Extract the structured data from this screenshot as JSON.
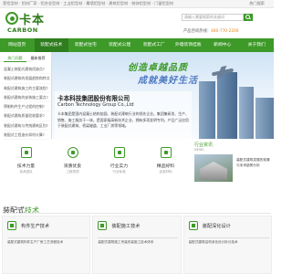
{
  "topbar": {
    "links": "营铝型材 · 铝材厂家 · 铝合金型材 · 工业铝型材 · 幕墙铝型材 · 建筑铝型材 · 装饰铝型材 · 门窗铝型材",
    "hotwords": "热门搜索"
  },
  "logo": {
    "cn": "卡本",
    "en": "CARBON"
  },
  "header": {
    "search_placeholder": "请输入需要搜索的关键词",
    "hotline_label": "产品咨询热线：",
    "hotline_number": "400-770-2200"
  },
  "nav": {
    "items": [
      {
        "label": "网站首页"
      },
      {
        "label": "装配式技术"
      },
      {
        "label": "装配式住宅"
      },
      {
        "label": "装配式公建"
      },
      {
        "label": "装配式工厂"
      },
      {
        "label": "外墙装饰挂板"
      },
      {
        "label": "新闻中心"
      },
      {
        "label": "关于我们"
      }
    ],
    "active_index": 1
  },
  "dropdown": {
    "tabs": [
      "热门问题",
      "最新推荐"
    ],
    "items": [
      "混凝土装配式建筑优缺点?",
      "装配式建筑的发展趋势和特点?",
      "装配式建筑施工的主要流程?",
      "装配式建筑的安装施工要点?",
      "预制构件生产过程的控制?",
      "装配式建筑质量验收要求?",
      "装配式建筑与传统建筑区别?",
      "装配式工程造价如何计算?"
    ]
  },
  "banner": {
    "slogan_line1": "创造卓越品质",
    "slogan_line2": "成就美好生活"
  },
  "company": {
    "name_cn": "卡本科技集团股份有限公司",
    "name_en": "Carbon Technology Group Co.,Ltd",
    "desc": "卡本集团是国内混凝土结构加固、装配式建筑行业的领先企业。集团集研发、生产、销售、施工服务于一体，是国家级高新技术企业，拥有多项发明专利，产品广泛应用于装配式建筑、桥梁隧道、工业厂房等领域。"
  },
  "features": [
    {
      "icon": "award-icon",
      "label": "技术力量",
      "sub": "技术团队"
    },
    {
      "icon": "lightbulb-icon",
      "label": "资质优良",
      "sub": "工程资质"
    },
    {
      "icon": "factory-icon",
      "label": "行业实力",
      "sub": "行业标准"
    },
    {
      "icon": "gift-icon",
      "label": "精品好料",
      "sub": "优选材料"
    }
  ],
  "news": {
    "title": "行业资讯",
    "sub": "NEWS",
    "text": "装配式建筑发展的前景与未来趋势分析"
  },
  "section": {
    "title_a": "装配式",
    "title_b": "技术"
  },
  "cards": [
    {
      "icon": "gear-icon",
      "title": "构件生产技术",
      "text": "装配式建筑构件生产厂房工艺流程技术"
    },
    {
      "icon": "layers-icon",
      "title": "装配施工技术",
      "text": "装配式建筑施工吊装安装施工技术体系"
    },
    {
      "icon": "pencil-icon",
      "title": "装配深化设计",
      "text": "装配式建筑结构深化设计拆分技术"
    }
  ]
}
